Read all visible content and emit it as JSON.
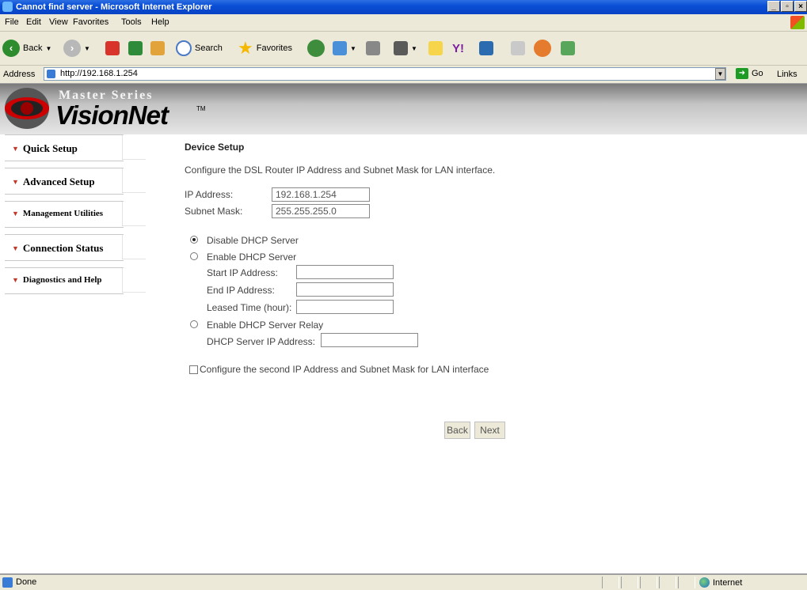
{
  "window": {
    "title": "Cannot find server - Microsoft Internet Explorer"
  },
  "menu": [
    "File",
    "Edit",
    "View",
    "Favorites",
    "Tools",
    "Help"
  ],
  "toolbar": {
    "back": "Back",
    "search": "Search",
    "favorites": "Favorites"
  },
  "address": {
    "label": "Address",
    "url": "http://192.168.1.254",
    "go": "Go",
    "links": "Links"
  },
  "logo": {
    "top": "Master Series",
    "main": "VisionNet",
    "tm": "TM"
  },
  "nav": [
    {
      "label": "Quick Setup"
    },
    {
      "label": "Advanced Setup"
    },
    {
      "label": "Management Utilities"
    },
    {
      "label": "Connection Status"
    },
    {
      "label": "Diagnostics and Help"
    }
  ],
  "page": {
    "heading": "Device Setup",
    "description": "Configure the DSL Router IP Address and Subnet Mask for LAN interface.",
    "ip_label": "IP Address:",
    "ip_value": "192.168.1.254",
    "mask_label": "Subnet Mask:",
    "mask_value": "255.255.255.0",
    "disable_dhcp": "Disable DHCP Server",
    "enable_dhcp": "Enable DHCP Server",
    "start_ip": "Start IP Address:",
    "end_ip": "End IP Address:",
    "leased_time": "Leased Time (hour):",
    "enable_relay": "Enable DHCP Server Relay",
    "dhcp_server_ip": "DHCP Server IP Address:",
    "second_ip": "Configure the second IP Address and Subnet Mask for LAN interface",
    "back_button": "Back",
    "next_button": "Next",
    "selected_dhcp_option": "Disable DHCP Server"
  },
  "status": {
    "text": "Done",
    "zone": "Internet"
  }
}
